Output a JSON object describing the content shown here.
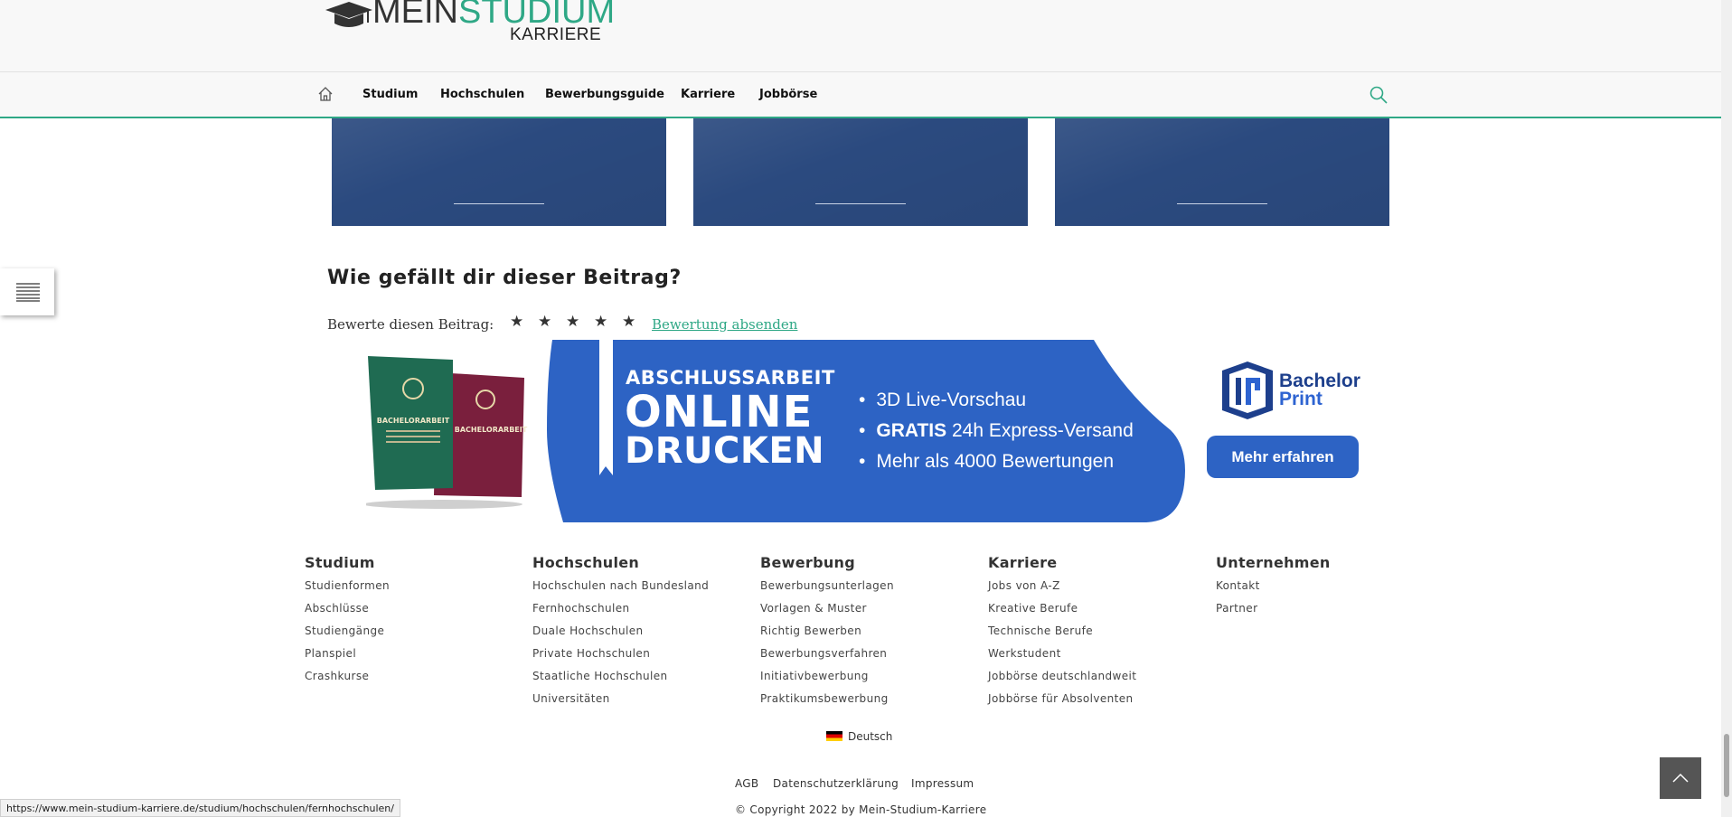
{
  "logo": {
    "word1": "MEIN",
    "word2": "STUDIUM",
    "word3": "KARRIERE"
  },
  "nav": {
    "home_icon": "home-icon",
    "items": [
      "Studium",
      "Hochschulen",
      "Bewerbungsguide",
      "Karriere",
      "Jobbörse"
    ],
    "search_icon": "search-icon"
  },
  "rating": {
    "title": "Wie gefällt dir dieser Beitrag?",
    "label": "Bewerte diesen Beitrag:",
    "star": "★",
    "submit": "Bewertung absenden"
  },
  "banner": {
    "title1": "ABSCHLUSSARBEIT",
    "title2": "ONLINE",
    "title3": "DRUCKEN",
    "bullet1": "3D Live-Vorschau",
    "bullet2_bold": "GRATIS",
    "bullet2_rest": " 24h Express-Versand",
    "bullet3": "Mehr als 4000 Bewertungen",
    "brand_line1": "Bachelor",
    "brand_line2": "Print",
    "cta": "Mehr erfahren",
    "book1_label": "BACHELORARBEIT",
    "book2_label": "BACHELORARBEIT",
    "colors": {
      "blue": "#2d63c4",
      "book_green": "#1f6b52",
      "book_red": "#7a1f3d"
    }
  },
  "footer": {
    "columns": [
      {
        "title": "Studium",
        "links": [
          "Studienformen",
          "Abschlüsse",
          "Studiengänge",
          "Planspiel",
          "Crashkurse"
        ]
      },
      {
        "title": "Hochschulen",
        "links": [
          "Hochschulen nach Bundesland",
          "Fernhochschulen",
          "Duale Hochschulen",
          "Private Hochschulen",
          "Staatliche Hochschulen",
          "Universitäten"
        ]
      },
      {
        "title": "Bewerbung",
        "links": [
          "Bewerbungsunterlagen",
          "Vorlagen & Muster",
          "Richtig Bewerben",
          "Bewerbungsverfahren",
          "Initiativbewerbung",
          "Praktikumsbewerbung"
        ]
      },
      {
        "title": "Karriere",
        "links": [
          "Jobs von A-Z",
          "Kreative Berufe",
          "Technische Berufe",
          "Werkstudent",
          "Jobbörse deutschlandweit",
          "Jobbörse für Absolventen"
        ]
      },
      {
        "title": "Unternehmen",
        "links": [
          "Kontakt",
          "Partner"
        ]
      }
    ],
    "language": "Deutsch",
    "legal": [
      "AGB",
      "Datenschutzerklärung",
      "Impressum"
    ],
    "copyright": "© Copyright 2022 by Mein-Studium-Karriere"
  },
  "status_url": "https://www.mein-studium-karriere.de/studium/hochschulen/fernhochschulen/",
  "colors": {
    "accent": "#2fa886",
    "card_blue": "#2b4a7f",
    "totop_bg": "#555555"
  }
}
